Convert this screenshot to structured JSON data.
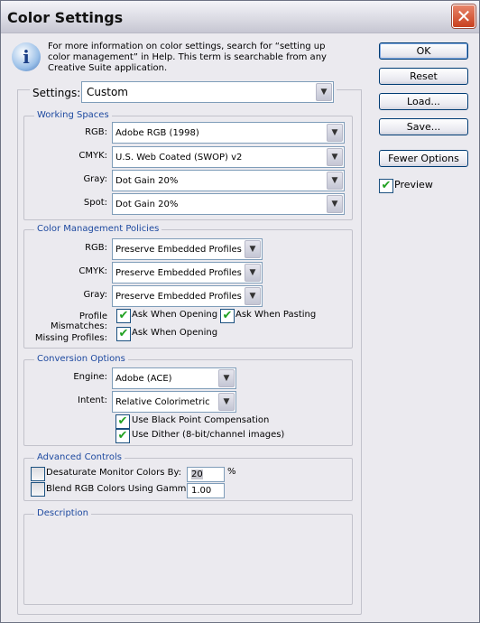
{
  "window": {
    "title": "Color Settings",
    "close_icon": "close-icon"
  },
  "info": {
    "icon": "info-icon",
    "text": "For more information on color settings, search for “setting up color management” in Help. This term is searchable from any Creative Suite application."
  },
  "settings": {
    "label": "Settings:",
    "value": "Custom"
  },
  "working_spaces": {
    "title": "Working Spaces",
    "rows": [
      {
        "label": "RGB:",
        "value": "Adobe RGB (1998)"
      },
      {
        "label": "CMYK:",
        "value": "U.S. Web Coated (SWOP) v2"
      },
      {
        "label": "Gray:",
        "value": "Dot Gain 20%"
      },
      {
        "label": "Spot:",
        "value": "Dot Gain 20%"
      }
    ]
  },
  "policies": {
    "title": "Color Management Policies",
    "rows": [
      {
        "label": "RGB:",
        "value": "Preserve Embedded Profiles"
      },
      {
        "label": "CMYK:",
        "value": "Preserve Embedded Profiles"
      },
      {
        "label": "Gray:",
        "value": "Preserve Embedded Profiles"
      }
    ],
    "mismatch_label": "Profile Mismatches:",
    "ask_opening": "Ask When Opening",
    "ask_opening_checked": true,
    "ask_pasting": "Ask When Pasting",
    "ask_pasting_checked": true,
    "missing_label": "Missing Profiles:",
    "missing_ask_opening": "Ask When Opening",
    "missing_checked": true
  },
  "conversion": {
    "title": "Conversion Options",
    "engine_label": "Engine:",
    "engine": "Adobe (ACE)",
    "intent_label": "Intent:",
    "intent": "Relative Colorimetric",
    "black_point": "Use Black Point Compensation",
    "black_point_checked": true,
    "dither": "Use Dither (8-bit/channel images)",
    "dither_checked": true
  },
  "advanced": {
    "title": "Advanced Controls",
    "desaturate_label": "Desaturate Monitor Colors By:",
    "desaturate_value": "20",
    "desaturate_unit": "%",
    "desaturate_checked": false,
    "blend_label": "Blend RGB Colors Using Gamma:",
    "blend_value": "1.00",
    "blend_checked": false
  },
  "description": {
    "title": "Description"
  },
  "buttons": {
    "ok": "OK",
    "reset": "Reset",
    "load": "Load...",
    "save": "Save...",
    "fewer": "Fewer Options"
  },
  "preview": {
    "label": "Preview",
    "checked": true
  },
  "colors": {
    "group_title": "#1e4aa0",
    "check": "#21a121"
  }
}
